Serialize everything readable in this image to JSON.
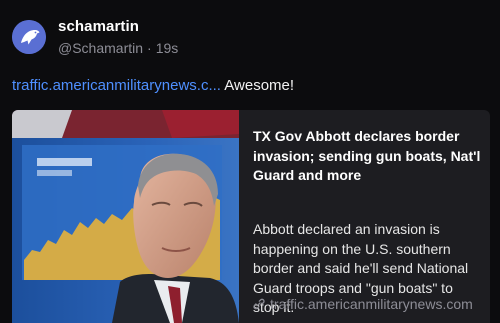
{
  "post": {
    "display_name": "schamartin",
    "handle": "@Schamartin",
    "separator": "·",
    "timestamp": "19s",
    "link_text": "traffic.americanmilitarynews.c...",
    "body_text": "Awesome!"
  },
  "card": {
    "title": "TX Gov Abbott declares border invasion; sending gun boats, Nat'l Guard and more",
    "description": "Abbott declared an invasion is happening on the U.S. southern border and said he'll send National Guard troops and \"gun boats\" to stop it.",
    "domain": "traffic.americanmilitarynews.com",
    "domain_icon": "link-icon",
    "thumbnail": "news-photo"
  },
  "avatar": {
    "icon": "eagle-icon",
    "color": "#5a6fd3"
  },
  "colors": {
    "background": "#0c0c0e",
    "link": "#4f90ff",
    "card": "#1d1d21",
    "muted": "#8d8d96"
  }
}
